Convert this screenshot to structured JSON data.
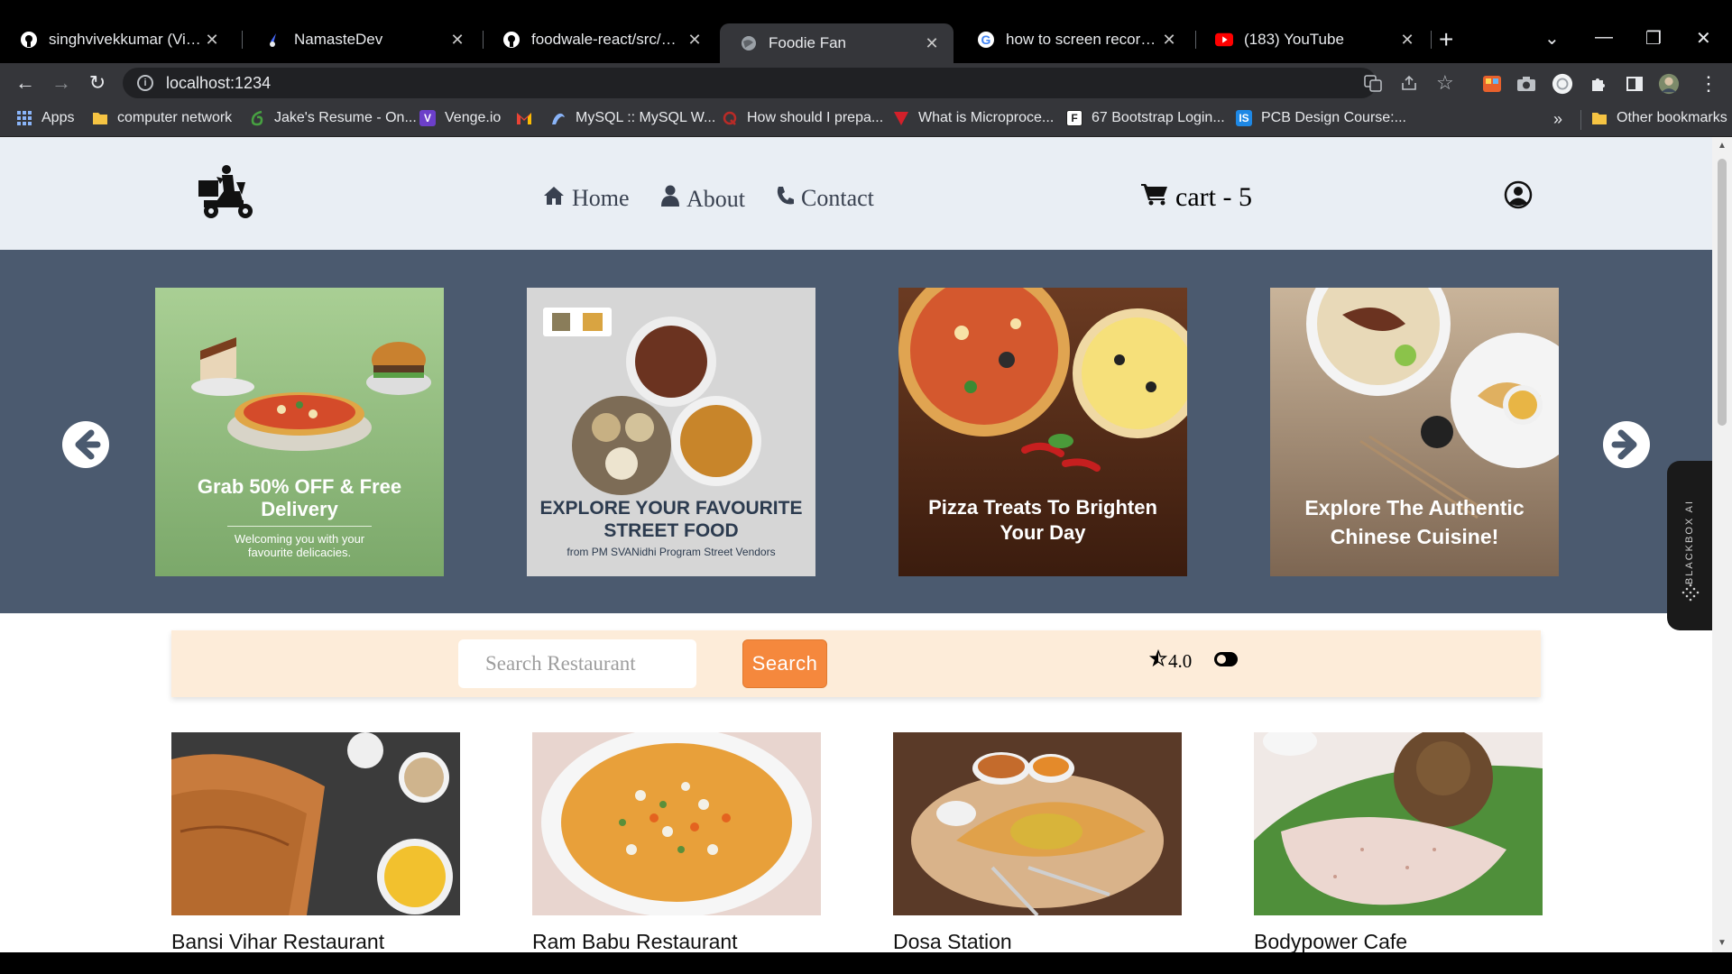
{
  "browser": {
    "tabs": [
      {
        "title": "singhvivekkumar (Vivek Kumar)",
        "icon": "github-icon"
      },
      {
        "title": "NamasteDev",
        "icon": "namastedev-icon"
      },
      {
        "title": "foodwale-react/src/components",
        "icon": "github-icon"
      },
      {
        "title": "Foodie Fan",
        "icon": "globe-icon",
        "active": true
      },
      {
        "title": "how to screen record in windows",
        "icon": "google-icon"
      },
      {
        "title": "(183) YouTube",
        "icon": "youtube-icon"
      }
    ],
    "url": "localhost:1234",
    "bookmarks": [
      {
        "label": "Apps",
        "icon": "apps-grid-icon"
      },
      {
        "label": "computer network",
        "icon": "folder-icon"
      },
      {
        "label": "Jake's Resume - On...",
        "icon": "overleaf-icon"
      },
      {
        "label": "Venge.io",
        "icon": "venge-icon"
      },
      {
        "label": "",
        "icon": "gmail-icon"
      },
      {
        "label": "MySQL :: MySQL W...",
        "icon": "mysql-icon"
      },
      {
        "label": "How should I prepa...",
        "icon": "quora-icon"
      },
      {
        "label": "What is Microproce...",
        "icon": "javatpoint-icon"
      },
      {
        "label": "67 Bootstrap Login...",
        "icon": "formget-icon"
      },
      {
        "label": "PCB Design Course:...",
        "icon": "pcb-icon"
      }
    ],
    "bookmarks_overflow": "»",
    "other_bookmarks": "Other bookmarks"
  },
  "header": {
    "nav": [
      {
        "label": "Home",
        "icon": "home-icon"
      },
      {
        "label": "About",
        "icon": "user-icon"
      },
      {
        "label": "Contact",
        "icon": "phone-icon"
      }
    ],
    "cart_label": "cart - 5"
  },
  "carousel": {
    "banners": [
      {
        "title": "Grab 50% OFF & Free Delivery",
        "subtitle": "Welcoming you with your favourite delicacies."
      },
      {
        "title": "EXPLORE YOUR FAVOURITE STREET FOOD",
        "subtitle": "from PM SVANidhi Program Street Vendors"
      },
      {
        "title": "Pizza Treats To Brighten Your Day"
      },
      {
        "title": "Explore The Authentic Chinese Cuisine!"
      }
    ]
  },
  "sidebar_widget": {
    "label": "BLACKBOX AI"
  },
  "filter": {
    "search_placeholder": "Search Restaurant",
    "search_button": "Search",
    "rating": "4.0"
  },
  "restaurants": [
    {
      "name": "Bansi Vihar Restaurant"
    },
    {
      "name": "Ram Babu Restaurant"
    },
    {
      "name": "Dosa Station"
    },
    {
      "name": "Bodypower Cafe"
    }
  ],
  "colors": {
    "header_bg": "#e9eef4",
    "carousel_bg": "#4b5a6f",
    "filter_bg": "#fdecd9",
    "search_button": "#f5883d"
  }
}
